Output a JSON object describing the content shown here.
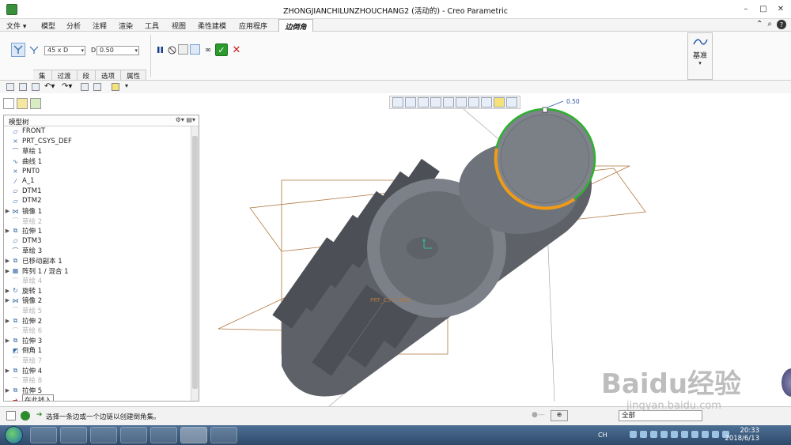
{
  "window": {
    "title": "ZHONGJIANCHILUNZHOUCHANG2 (活动的) - Creo Parametric"
  },
  "menu": {
    "file": "文件",
    "items": [
      "模型",
      "分析",
      "注释",
      "渲染",
      "工具",
      "视图",
      "柔性建模",
      "应用程序"
    ],
    "active_tab": "边倒角"
  },
  "ribbon": {
    "type_select": "45 x D",
    "d_label": "D",
    "d_value": "0.50",
    "subtabs": [
      "集",
      "过渡",
      "段",
      "选项",
      "属性"
    ],
    "datum_label": "基准"
  },
  "model_tree": {
    "title": "模型树",
    "items": [
      {
        "label": "FRONT",
        "icon": "datum-plane-icon",
        "expand": false,
        "grey": false
      },
      {
        "label": "PRT_CSYS_DEF",
        "icon": "csys-icon",
        "expand": false,
        "grey": false
      },
      {
        "label": "草绘 1",
        "icon": "sketch-icon",
        "expand": false,
        "grey": false
      },
      {
        "label": "曲线 1",
        "icon": "curve-icon",
        "expand": false,
        "grey": false
      },
      {
        "label": "PNT0",
        "icon": "point-icon",
        "expand": false,
        "grey": false
      },
      {
        "label": "A_1",
        "icon": "axis-icon",
        "expand": false,
        "grey": false
      },
      {
        "label": "DTM1",
        "icon": "datum-plane-icon",
        "expand": false,
        "grey": false
      },
      {
        "label": "DTM2",
        "icon": "datum-plane-icon",
        "expand": false,
        "grey": false
      },
      {
        "label": "镜像 1",
        "icon": "mirror-icon",
        "expand": true,
        "grey": false
      },
      {
        "label": "草绘 2",
        "icon": "sketch-icon",
        "expand": false,
        "grey": true
      },
      {
        "label": "拉伸 1",
        "icon": "extrude-icon",
        "expand": true,
        "grey": false
      },
      {
        "label": "DTM3",
        "icon": "datum-plane-icon",
        "expand": false,
        "grey": false
      },
      {
        "label": "草绘 3",
        "icon": "sketch-icon",
        "expand": false,
        "grey": false
      },
      {
        "label": "已移动副本 1",
        "icon": "copy-icon",
        "expand": true,
        "grey": false
      },
      {
        "label": "阵列 1 / 混合 1",
        "icon": "pattern-icon",
        "expand": true,
        "grey": false
      },
      {
        "label": "草绘 4",
        "icon": "sketch-icon",
        "expand": false,
        "grey": true
      },
      {
        "label": "旋转 1",
        "icon": "revolve-icon",
        "expand": true,
        "grey": false
      },
      {
        "label": "镜像 2",
        "icon": "mirror-icon",
        "expand": true,
        "grey": false
      },
      {
        "label": "草绘 5",
        "icon": "sketch-icon",
        "expand": false,
        "grey": true
      },
      {
        "label": "拉伸 2",
        "icon": "extrude-icon",
        "expand": true,
        "grey": false
      },
      {
        "label": "草绘 6",
        "icon": "sketch-icon",
        "expand": false,
        "grey": true
      },
      {
        "label": "拉伸 3",
        "icon": "extrude-icon",
        "expand": true,
        "grey": false
      },
      {
        "label": "倒角 1",
        "icon": "chamfer-icon",
        "expand": false,
        "grey": false
      },
      {
        "label": "草绘 7",
        "icon": "sketch-icon",
        "expand": false,
        "grey": true
      },
      {
        "label": "拉伸 4",
        "icon": "extrude-icon",
        "expand": true,
        "grey": false
      },
      {
        "label": "草绘 8",
        "icon": "sketch-icon",
        "expand": false,
        "grey": true
      },
      {
        "label": "拉伸 5",
        "icon": "extrude-icon",
        "expand": true,
        "grey": false
      },
      {
        "label": "在此插入",
        "icon": "insert-arrow-icon",
        "expand": false,
        "grey": false,
        "insert": true
      }
    ]
  },
  "viewport": {
    "dimension_label": "0.50",
    "csys_label": "PRT_CSYS_DEF"
  },
  "status": {
    "message": "选择一条边或一个边链以创建倒角集。",
    "filter": "全部"
  },
  "taskbar": {
    "time": "20:33",
    "date": "2018/6/13",
    "lang": "CH"
  },
  "watermark": {
    "text": "Baidu经验",
    "url": "jingyan.baidu.com"
  },
  "colors": {
    "selection_green": "#2fb02f",
    "selection_orange": "#f09a1a",
    "datum_plane": "#b07840",
    "dimension_blue": "#3355aa"
  }
}
